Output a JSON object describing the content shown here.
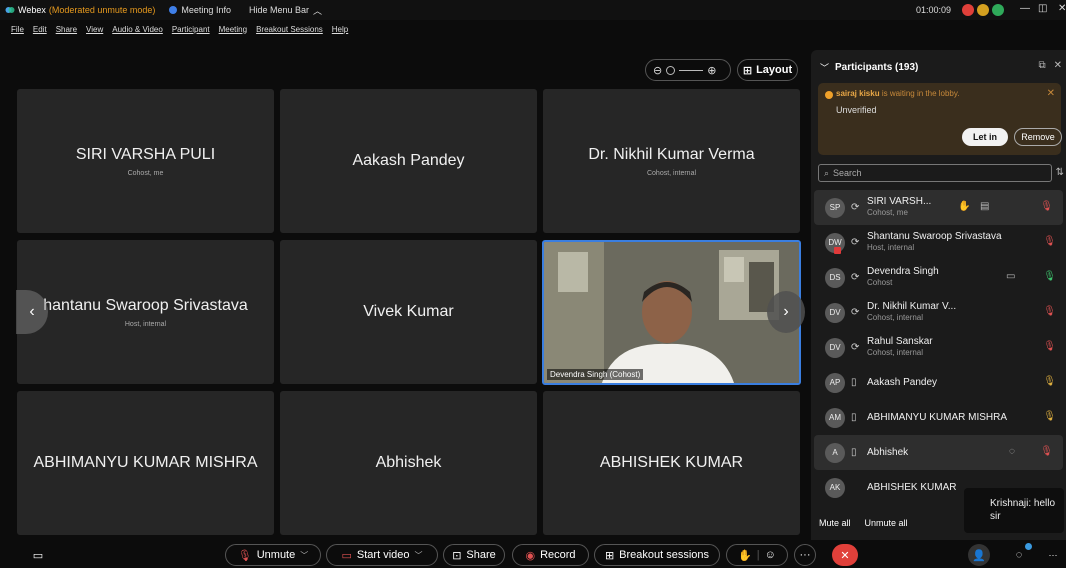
{
  "titlebar": {
    "app_name": "Webex",
    "mode": "(Moderated unmute mode)",
    "meeting_info": "Meeting Info",
    "hide_menu": "Hide Menu Bar",
    "timer": "01:00:09"
  },
  "menubar": [
    "File",
    "Edit",
    "Share",
    "View",
    "Audio & Video",
    "Participant",
    "Meeting",
    "Breakout Sessions",
    "Help"
  ],
  "stage": {
    "layout_label": "Layout",
    "tiles": [
      {
        "name": "SIRI VARSHA PULI",
        "sub": "Cohost, me"
      },
      {
        "name": "Aakash Pandey",
        "sub": ""
      },
      {
        "name": "Dr. Nikhil Kumar Verma",
        "sub": "Cohost, internal"
      },
      {
        "name": "hantanu Swaroop Srivastava",
        "sub": "Host, internal"
      },
      {
        "name": "Vivek Kumar",
        "sub": ""
      },
      {
        "name": "",
        "sub": "",
        "video_label": "Devendra Singh (Cohost)"
      },
      {
        "name": "ABHIMANYU KUMAR MISHRA",
        "sub": ""
      },
      {
        "name": "Abhishek",
        "sub": ""
      },
      {
        "name": "ABHISHEK KUMAR",
        "sub": ""
      }
    ]
  },
  "panel": {
    "title": "Participants (193)",
    "lobby": {
      "name": "sairaj kisku",
      "message": "is waiting in the lobby.",
      "status": "Unverified",
      "let_in": "Let in",
      "remove": "Remove"
    },
    "search_placeholder": "Search",
    "participants": [
      {
        "initials": "SP",
        "name": "SIRI VARSH...",
        "role": "Cohost, me"
      },
      {
        "initials": "DW",
        "name": "Shantanu Swaroop Srivastava",
        "role": "Host, internal"
      },
      {
        "initials": "DS",
        "name": "Devendra Singh",
        "role": "Cohost"
      },
      {
        "initials": "DV",
        "name": "Dr. Nikhil Kumar V...",
        "role": "Cohost, internal"
      },
      {
        "initials": "DV",
        "name": "Rahul Sanskar",
        "role": "Cohost, internal"
      },
      {
        "initials": "AP",
        "name": "Aakash Pandey",
        "role": ""
      },
      {
        "initials": "AM",
        "name": "ABHIMANYU KUMAR MISHRA",
        "role": ""
      },
      {
        "initials": "A",
        "name": "Abhishek",
        "role": ""
      },
      {
        "initials": "AK",
        "name": "ABHISHEK KUMAR",
        "role": ""
      }
    ],
    "mute_all": "Mute all",
    "unmute_all": "Unmute all"
  },
  "chat_popup": {
    "line1": "Krishnaji: hello",
    "line2": "sir"
  },
  "bottombar": {
    "unmute": "Unmute",
    "start_video": "Start video",
    "share": "Share",
    "record": "Record",
    "breakout": "Breakout sessions"
  },
  "colors": {
    "accent_blue": "#3a7ee0",
    "mute_red": "#e05252",
    "lobby_orange": "#e8a746",
    "end_red": "#e0403a"
  }
}
